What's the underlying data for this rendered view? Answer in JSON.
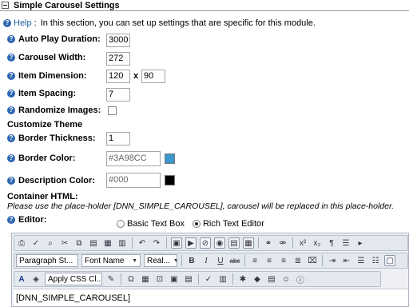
{
  "section": {
    "title": "Simple Carousel Settings"
  },
  "help": {
    "link": "Help",
    "sep": ":",
    "text": "In this section, you can set up settings that are specific for this module."
  },
  "settings": {
    "auto_play_label": "Auto Play Duration:",
    "auto_play_value": "3000",
    "width_label": "Carousel Width:",
    "width_value": "272",
    "item_dim_label": "Item Dimension:",
    "item_dim_w": "120",
    "item_dim_x": "x",
    "item_dim_h": "90",
    "spacing_label": "Item Spacing:",
    "spacing_value": "7",
    "randomize_label": "Randomize Images:",
    "randomize_checked": false
  },
  "theme": {
    "heading": "Customize Theme",
    "border_thickness_label": "Border Thickness:",
    "border_thickness_value": "1",
    "border_color_label": "Border Color:",
    "border_color_value": "#3A98CC",
    "border_color_swatch": "#3A98CC",
    "desc_color_label": "Description Color:",
    "desc_color_value": "#000",
    "desc_color_swatch": "#000000"
  },
  "container": {
    "heading": "Container HTML:",
    "note": "Please use the place-holder [DNN_SIMPLE_CAROUSEL], carousel will be replaced in this place-holder."
  },
  "editor": {
    "label": "Editor:",
    "option_basic": "Basic Text Box",
    "option_rich": "Rich Text Editor",
    "selected": "rich",
    "paragraph_style": "Paragraph St...",
    "font_name": "Font Name",
    "font_size": "Real...",
    "css_class": "Apply CSS Cl...",
    "content": "[DNN_SIMPLE_CAROUSEL]"
  },
  "icons": {
    "help": "question-mark-icon",
    "bold": "B",
    "italic": "I",
    "underline": "U",
    "strike": "abc",
    "omega": "Ω",
    "superscript": "x²",
    "subscript": "x₂",
    "pilcrow": "¶"
  }
}
